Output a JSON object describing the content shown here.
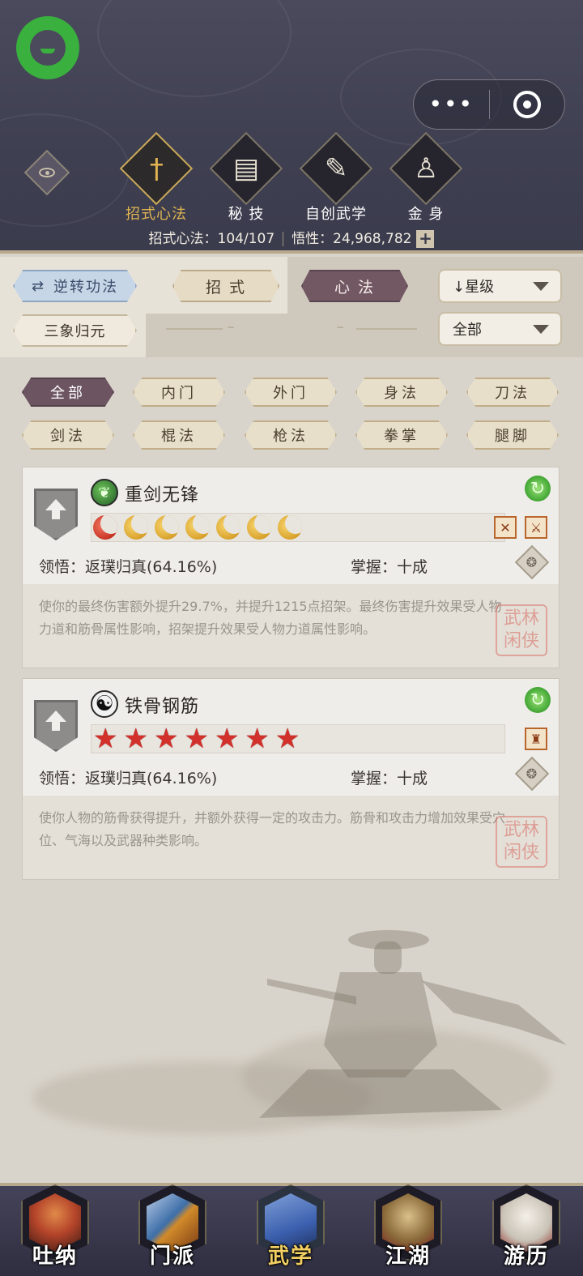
{
  "header": {
    "tabs": [
      {
        "label": "招式心法",
        "icon": "sword-icon",
        "glyph": "†",
        "active": true
      },
      {
        "label": "秘 技",
        "icon": "book-icon",
        "glyph": "▤",
        "active": false
      },
      {
        "label": "自创武学",
        "icon": "scroll-icon",
        "glyph": "✎",
        "active": false
      },
      {
        "label": "金 身",
        "icon": "meditation-icon",
        "glyph": "♙",
        "active": false
      }
    ],
    "stat_skills": "招式心法：104/107",
    "stat_insight": "悟性：24,968,782",
    "plus_label": "+"
  },
  "filters": {
    "reverse_label": "逆转功法",
    "zhaoshi_label": "招 式",
    "xinfa_label": "心 法",
    "sanxiang_label": "三象归元",
    "sort_value": "↓星级",
    "scope_value": "全部"
  },
  "categories": [
    "全部",
    "内门",
    "外门",
    "身法",
    "刀法",
    "剑法",
    "棍法",
    "枪法",
    "拳掌",
    "腿脚"
  ],
  "skills": [
    {
      "name": "重剑无锋",
      "icon": "leaf-skill-icon",
      "rating_type": "moons",
      "rating_count": 7,
      "comprehension": "领悟：返璞归真(64.16%)",
      "mastery": "掌握：十成",
      "description": "使你的最终伤害额外提升29.7%，并提升1215点招架。最终伤害提升效果受人物力道和筋骨属性影响，招架提升效果受人物力道属性影响。",
      "tags": [
        "✕",
        "⚔"
      ],
      "seal_text": "武林闲侠"
    },
    {
      "name": "铁骨钢筋",
      "icon": "taiji-icon",
      "rating_type": "stars",
      "rating_count": 7,
      "comprehension": "领悟：返璞归真(64.16%)",
      "mastery": "掌握：十成",
      "description": "使你人物的筋骨获得提升，并额外获得一定的攻击力。筋骨和攻击力增加效果受穴位、气海以及武器种类影响。",
      "tags": [
        "♜"
      ],
      "seal_text": "武林闲侠"
    }
  ],
  "bottom_nav": [
    {
      "label": "吐纳",
      "icon": "monk-icon",
      "color": "#b4442a",
      "active": false
    },
    {
      "label": "门派",
      "icon": "sect-icon",
      "color": "#3e6fa8",
      "active": false
    },
    {
      "label": "武学",
      "icon": "manual-icon",
      "color": "#3b5fae",
      "active": true
    },
    {
      "label": "江湖",
      "icon": "straw-hat-icon",
      "color": "#8a6a3a",
      "active": false
    },
    {
      "label": "游历",
      "icon": "horse-icon",
      "color": "#c9c2b6",
      "active": false
    }
  ],
  "colors": {
    "header_bg": "#3f4052",
    "active_gold": "#e0b452",
    "active_tab": "#6c5460",
    "accent_green": "#3ab03e"
  }
}
